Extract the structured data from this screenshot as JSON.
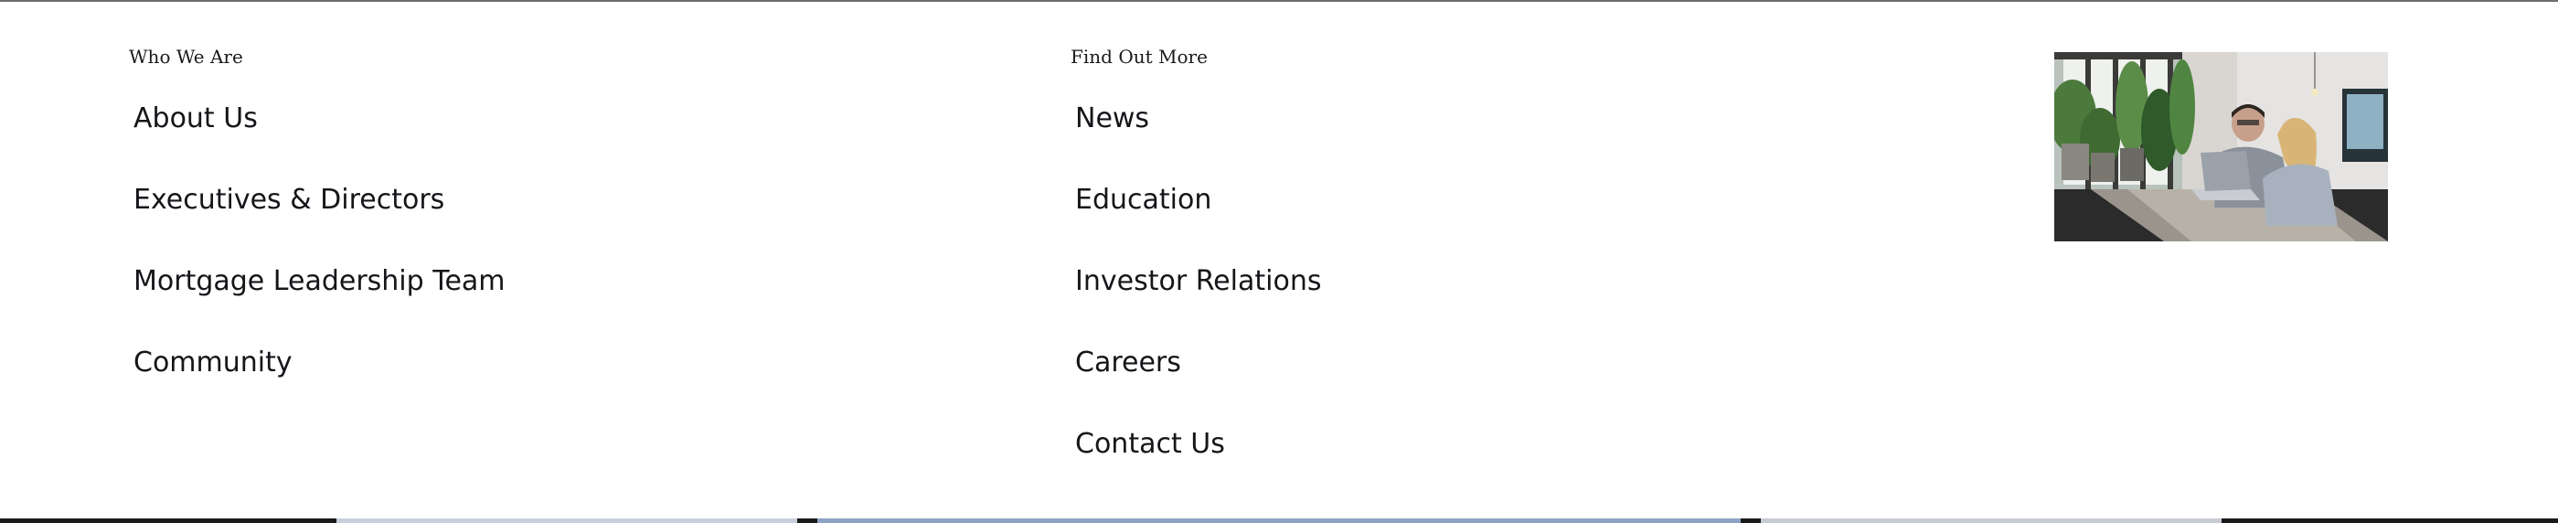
{
  "footer": {
    "who_we_are": {
      "heading": "Who We Are",
      "links": [
        {
          "label": "About Us"
        },
        {
          "label": "Executives & Directors"
        },
        {
          "label": "Mortgage Leadership Team"
        },
        {
          "label": "Community"
        }
      ]
    },
    "find_out_more": {
      "heading": "Find Out More",
      "links": [
        {
          "label": "News"
        },
        {
          "label": "Education"
        },
        {
          "label": "Investor Relations"
        },
        {
          "label": "Careers"
        },
        {
          "label": "Contact Us"
        }
      ]
    }
  },
  "colors": {
    "text": "#15151a",
    "background": "#ffffff"
  }
}
